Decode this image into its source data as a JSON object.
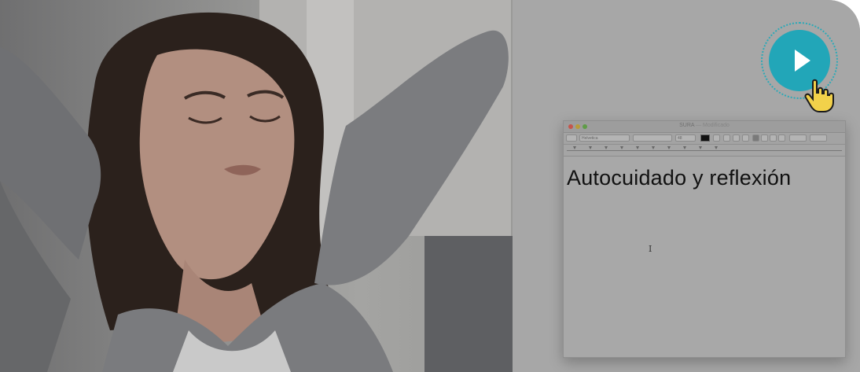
{
  "video": {
    "play_button_label": "Play",
    "play_icon": "play-triangle-icon",
    "hand_icon": "pointing-hand-icon"
  },
  "editor_window": {
    "title": "SURA",
    "edited": "— Modificado",
    "toolbar": {
      "font_family": "Helvetica",
      "font_style": "",
      "font_size": "48"
    },
    "document_text": "Autocuidado y reflexión"
  },
  "colors": {
    "play_button": "#22a6b8",
    "hand_cursor": "#f2d14a"
  }
}
